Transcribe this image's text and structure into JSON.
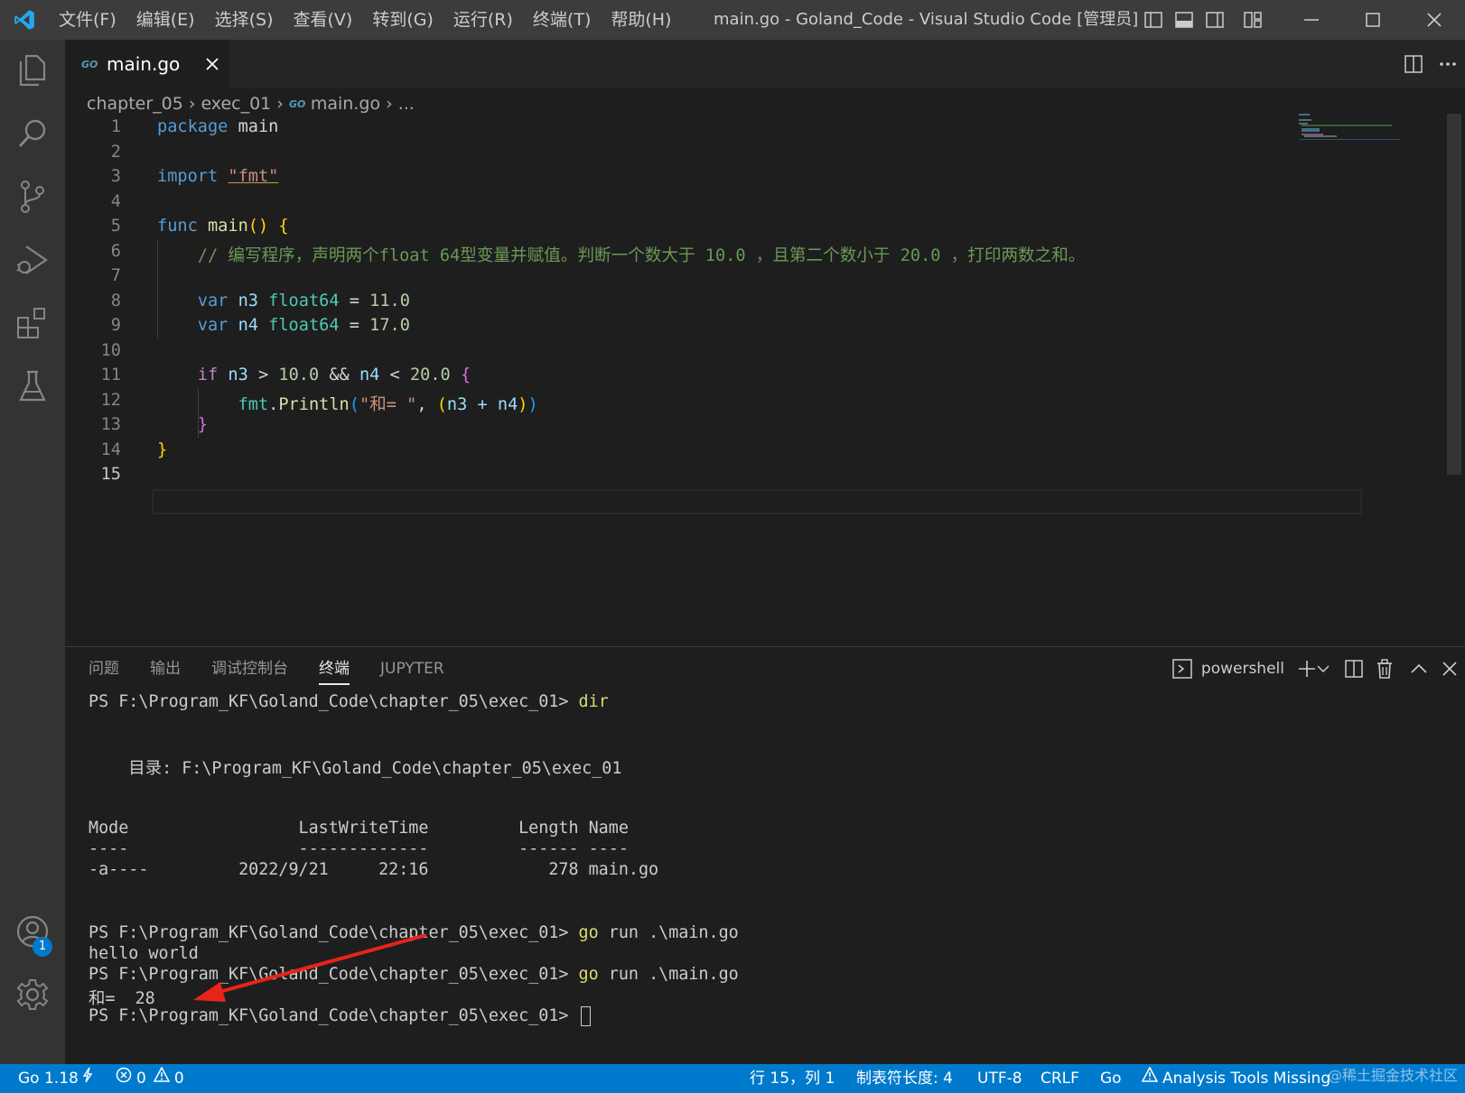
{
  "titlebar": {
    "menu": [
      "文件(F)",
      "编辑(E)",
      "选择(S)",
      "查看(V)",
      "转到(G)",
      "运行(R)",
      "终端(T)",
      "帮助(H)"
    ],
    "window_title": "main.go - Goland_Code - Visual Studio Code [管理员]"
  },
  "activity_bar": {
    "items": [
      "explorer-icon",
      "search-icon",
      "source-control-icon",
      "run-debug-icon",
      "extensions-icon",
      "testing-icon"
    ],
    "account_badge": "1"
  },
  "editor": {
    "tab": {
      "label": "main.go",
      "icon": "go-file-icon"
    },
    "breadcrumb": [
      "chapter_05",
      "exec_01",
      "main.go",
      "..."
    ],
    "lines": [
      {
        "num": "1"
      },
      {
        "num": "2"
      },
      {
        "num": "3"
      },
      {
        "num": "4"
      },
      {
        "num": "5"
      },
      {
        "num": "6"
      },
      {
        "num": "7"
      },
      {
        "num": "8"
      },
      {
        "num": "9"
      },
      {
        "num": "10"
      },
      {
        "num": "11"
      },
      {
        "num": "12"
      },
      {
        "num": "13"
      },
      {
        "num": "14"
      },
      {
        "num": "15"
      }
    ],
    "code": {
      "l1_kw": "package",
      "l1_name": "main",
      "l3_kw": "import",
      "l3_str": "\"fmt\"",
      "l5_kw": "func",
      "l5_fn": "main",
      "l5_paren": "()",
      "l5_brace": "{",
      "l6_comment": "// 编写程序，声明两个float 64型变量并赋值。判断一个数大于 10.0 ，且第二个数小于 20.0 ，打印两数之和。",
      "l8_kw": "var",
      "l8_var": "n3",
      "l8_type": "float64",
      "l8_eq": "=",
      "l8_val": "11.0",
      "l9_kw": "var",
      "l9_var": "n4",
      "l9_type": "float64",
      "l9_eq": "=",
      "l9_val": "17.0",
      "l11_kw": "if",
      "l11_a": "n3",
      "l11_gt": ">",
      "l11_v1": "10.0",
      "l11_and": "&&",
      "l11_b": "n4",
      "l11_lt": "<",
      "l11_v2": "20.0",
      "l11_brace": "{",
      "l12_pkg": "fmt",
      "l12_dot": ".",
      "l12_fn": "Println",
      "l12_open": "(",
      "l12_str": "\"和= \"",
      "l12_comma": ",",
      "l12_p1": "(",
      "l12_expr": "n3 + n4",
      "l12_p2": ")",
      "l12_close": ")",
      "l13_brace": "}",
      "l14_brace": "}"
    }
  },
  "panel": {
    "tabs": [
      "问题",
      "输出",
      "调试控制台",
      "终端",
      "JUPYTER"
    ],
    "active_tab": "终端",
    "shell": "powershell",
    "terminal": {
      "prompt": "PS F:\\Program_KF\\Goland_Code\\chapter_05\\exec_01>",
      "cmd_dir": "dir",
      "dir_label": "    目录: F:\\Program_KF\\Goland_Code\\chapter_05\\exec_01",
      "header": "Mode                 LastWriteTime         Length Name",
      "divider": "----                 -------------         ------ ----",
      "row": "-a----         2022/9/21     22:16            278 main.go",
      "cmd_go": "go",
      "cmd_run": "run .\\main.go",
      "out1": "hello world",
      "out2": "和=  28"
    }
  },
  "statusbar": {
    "go_version": "Go 1.18",
    "errors": "0",
    "warnings": "0",
    "position": "行 15，列 1",
    "indent": "制表符长度: 4",
    "encoding": "UTF-8",
    "eol": "CRLF",
    "language": "Go",
    "analysis": "Analysis Tools Missing"
  },
  "watermark": "@稀土掘金技术社区",
  "colors": {
    "accent": "#007acc",
    "titlebar": "#3c3c3c",
    "activity": "#333333",
    "editor_bg": "#1e1e1e",
    "arrow": "#e8231b"
  }
}
